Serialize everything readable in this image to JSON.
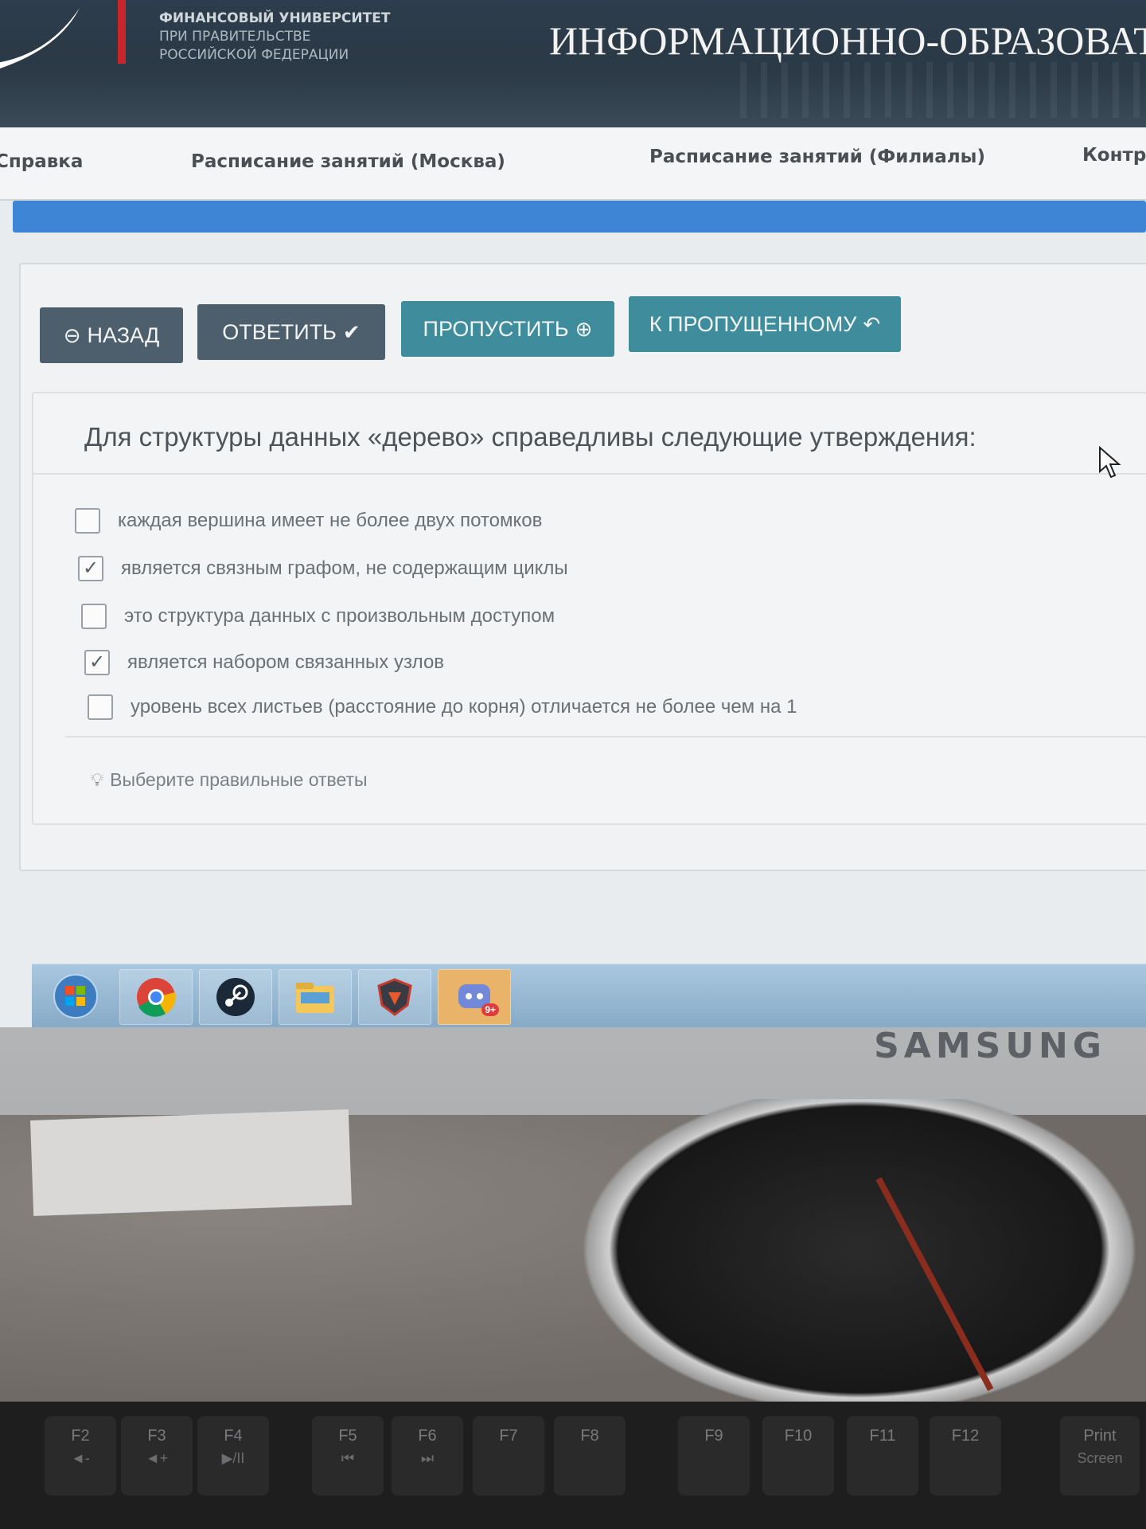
{
  "header": {
    "university_line1": "ФИНАНСОВЫЙ УНИВЕРСИТЕТ",
    "university_line2": "ПРИ ПРАВИТЕЛЬСТВЕ",
    "university_line3": "РОССИЙСКОЙ ФЕДЕРАЦИИ",
    "portal_title": "ИНФОРМАЦИОННО-ОБРАЗОВАТ"
  },
  "nav": {
    "items": [
      {
        "label": "Справка"
      },
      {
        "label": "Расписание занятий (Москва)"
      },
      {
        "label": "Расписание занятий (Филиалы)"
      },
      {
        "label": "Контро"
      }
    ]
  },
  "toolbar": {
    "back_label": "НАЗАД",
    "answer_label": "ОТВЕТИТЬ",
    "skip_label": "ПРОПУСТИТЬ",
    "to_skipped_label": "К ПРОПУЩЕННОМУ"
  },
  "question": {
    "text": "Для структуры данных «дерево» справедливы следующие утверждения:",
    "options": [
      {
        "label": "каждая вершина имеет не более двух потомков",
        "checked": false
      },
      {
        "label": "является связным графом, не содержащим циклы",
        "checked": true
      },
      {
        "label": "это структура данных с произвольным доступом",
        "checked": false
      },
      {
        "label": "является набором связанных узлов",
        "checked": true
      },
      {
        "label": "уровень всех листьев (расстояние до корня) отличается не более чем на 1",
        "checked": false
      }
    ],
    "hint": "Выберите правильные ответы"
  },
  "taskbar": {
    "items": [
      "start-orb-icon",
      "chrome-icon",
      "steam-icon",
      "file-explorer-icon",
      "shield-app-icon",
      "discord-icon"
    ],
    "discord_badge": "9+"
  },
  "monitor": {
    "brand": "SAMSUNG"
  },
  "keyboard": {
    "keys": [
      {
        "label": "F2",
        "sub": "◄-"
      },
      {
        "label": "F3",
        "sub": "◄+"
      },
      {
        "label": "F4",
        "sub": "▶/II"
      },
      {
        "label": "F5",
        "sub": "⏮"
      },
      {
        "label": "F6",
        "sub": "⏭"
      },
      {
        "label": "F7",
        "sub": ""
      },
      {
        "label": "F8",
        "sub": ""
      },
      {
        "label": "F9",
        "sub": ""
      },
      {
        "label": "F10",
        "sub": ""
      },
      {
        "label": "F11",
        "sub": ""
      },
      {
        "label": "F12",
        "sub": ""
      },
      {
        "label": "Print",
        "sub": "Screen"
      }
    ]
  },
  "colors": {
    "header_bg": "#2d3d4c",
    "accent_blue": "#3f85d6",
    "button_dark": "#4d5f6c",
    "button_teal": "#3f8d9c",
    "brand_red": "#c8262b"
  }
}
